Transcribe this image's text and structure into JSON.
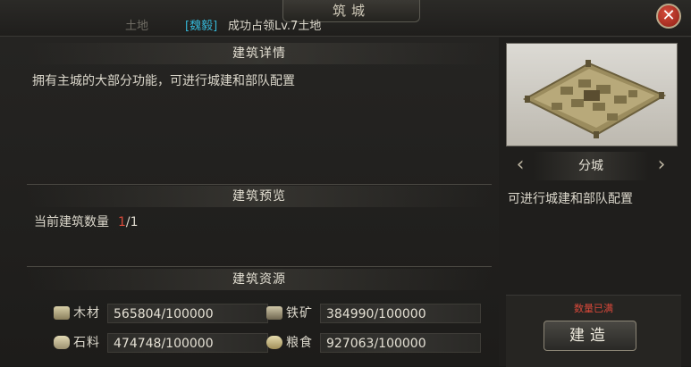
{
  "window": {
    "title": "筑城",
    "close_label": "✕"
  },
  "notice": {
    "faded_text": "土地",
    "tag": "[魏毅]",
    "message": "成功占领Lv.7土地"
  },
  "details": {
    "title": "建筑详情",
    "description": "拥有主城的大部分功能，可进行城建和部队配置"
  },
  "preview_section": {
    "title": "建筑预览",
    "count_label": "当前建筑数量",
    "count_current": "1",
    "count_total": "/1"
  },
  "resources": {
    "title": "建筑资源",
    "items": [
      {
        "icon": "wood-icon",
        "label": "木材",
        "value": "565804/100000"
      },
      {
        "icon": "iron-icon",
        "label": "铁矿",
        "value": "384990/100000"
      },
      {
        "icon": "stone-icon",
        "label": "石料",
        "value": "474748/100000"
      },
      {
        "icon": "grain-icon",
        "label": "粮食",
        "value": "927063/100000"
      }
    ]
  },
  "side": {
    "building_name": "分城",
    "description": "可进行城建和部队配置",
    "limit_text": "数量已满",
    "build_label": "建造"
  },
  "colors": {
    "accent_red": "#d84a3a",
    "tag_cyan": "#35b6d6"
  }
}
